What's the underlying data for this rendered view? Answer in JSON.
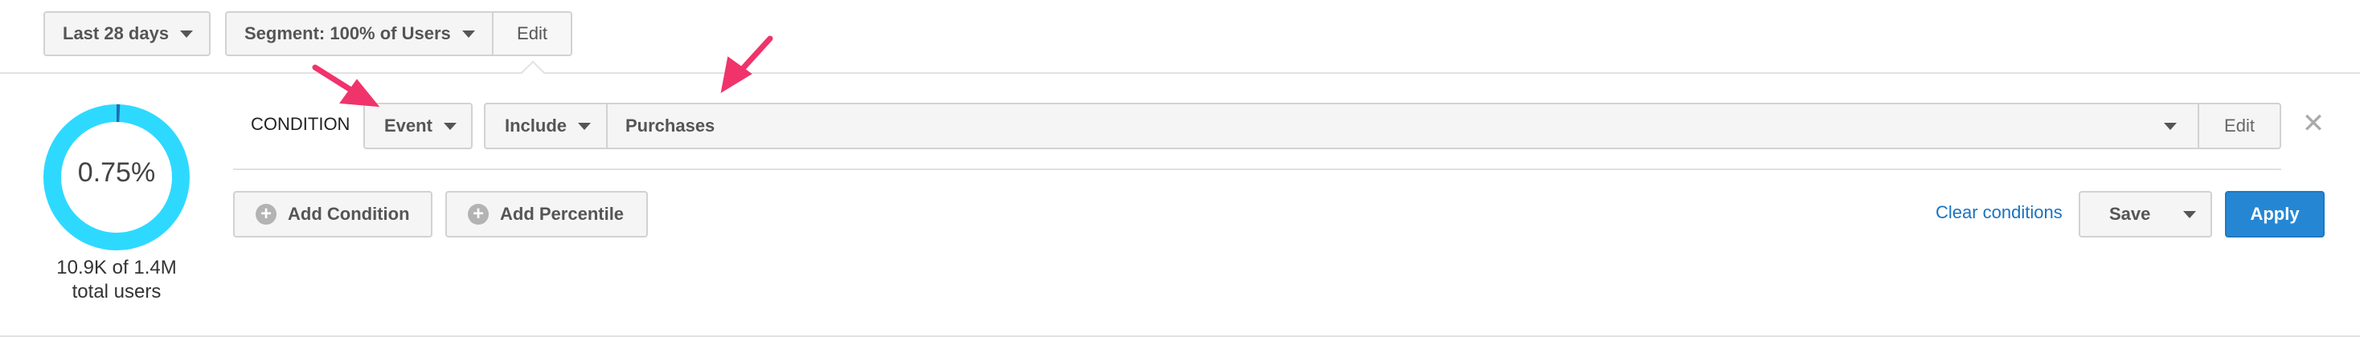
{
  "toolbar": {
    "date_range": "Last 28 days",
    "segment": "Segment: 100% of Users",
    "edit": "Edit"
  },
  "summary": {
    "percent": "0.75%",
    "percent_value": 0.75,
    "count": "10.9K of 1.4M",
    "count_suffix": "total users",
    "ring_color": "#2ed9ff"
  },
  "condition": {
    "label": "CONDITION",
    "type": "Event",
    "mode": "Include",
    "value": "Purchases",
    "edit": "Edit"
  },
  "actions": {
    "add_condition": "Add Condition",
    "add_percentile": "Add Percentile",
    "clear": "Clear conditions",
    "save": "Save",
    "apply": "Apply"
  },
  "colors": {
    "accent": "#2587d4",
    "link": "#1a73c0",
    "annotation_arrow": "#f0336b"
  }
}
